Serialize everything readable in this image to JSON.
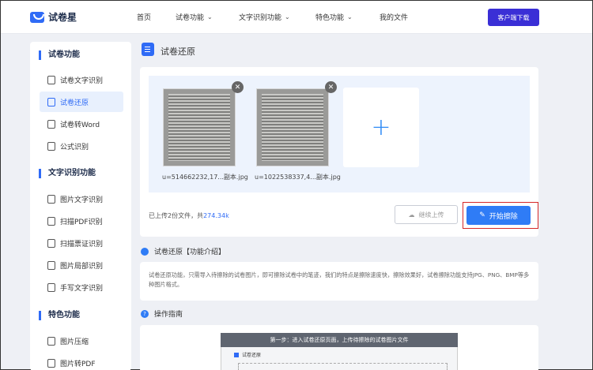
{
  "header": {
    "brand": "试卷星",
    "nav": [
      "首页",
      "试卷功能",
      "文字识别功能",
      "特色功能",
      "我的文件"
    ],
    "download_label": "客户端下载"
  },
  "sidebar": {
    "sections": [
      {
        "title": "试卷功能",
        "items": [
          "试卷文字识别",
          "试卷还原",
          "试卷转Word",
          "公式识别"
        ]
      },
      {
        "title": "文字识别功能",
        "items": [
          "图片文字识别",
          "扫描PDF识别",
          "扫描票证识别",
          "图片局部识别",
          "手写文字识别"
        ]
      },
      {
        "title": "特色功能",
        "items": [
          "图片压缩",
          "图片转PDF"
        ]
      }
    ],
    "active_item": "试卷还原"
  },
  "main": {
    "title": "试卷还原",
    "files": [
      {
        "name": "u=514662232,17...副本.jpg"
      },
      {
        "name": "u=1022538337,4...副本.jpg"
      }
    ],
    "add_symbol": "+",
    "upload_status_prefix": "已上传2份文件，共",
    "upload_size": "274.34k",
    "continue_upload_label": "继续上传",
    "start_erase_label": "开始擦除",
    "intro_title": "试卷还原【功能介绍】",
    "intro_text": "试卷还原功能，只需导入待擦除的试卷图片，即可擦除试卷中的笔迹，我们的特点是擦除速度快，擦除效果好，试卷擦除功能支持JPG、PNG、BMP等多种图片格式。",
    "guide_title": "操作指南",
    "guide_step": "第一步：进入试卷还原页面，上传待擦除的试卷图片文件",
    "guide_sub": "试卷还原"
  }
}
